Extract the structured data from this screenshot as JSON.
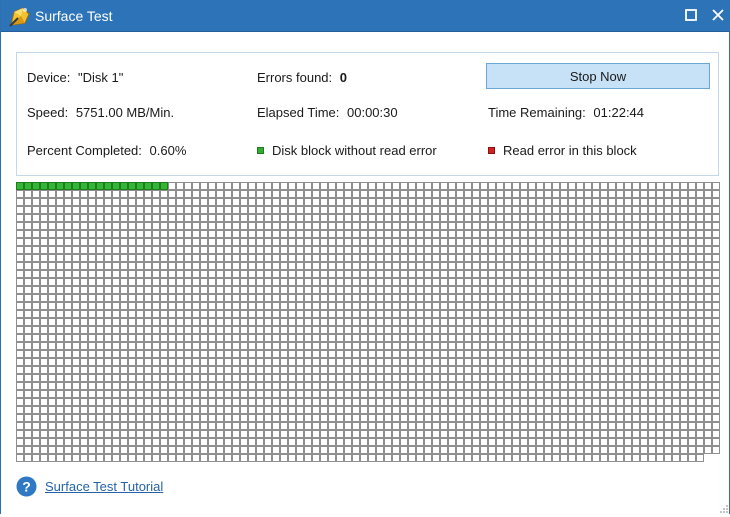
{
  "window": {
    "title": "Surface Test",
    "icon": "surface-test-app-icon",
    "maximize_icon": "maximize-icon",
    "close_icon": "close-icon"
  },
  "info": {
    "device_label": "Device:",
    "device_value": "\"Disk 1\"",
    "errors_label": "Errors found:",
    "errors_value": "0",
    "speed_label": "Speed:",
    "speed_value": "5751.00 MB/Min.",
    "elapsed_label": "Elapsed Time:",
    "elapsed_value": "00:00:30",
    "remaining_label": "Time Remaining:",
    "remaining_value": "01:22:44",
    "percent_label": "Percent Completed:",
    "percent_value": "0.60%",
    "legend_ok": "Disk block without read error",
    "legend_err": "Read error in this block"
  },
  "actions": {
    "stop_label": "Stop Now"
  },
  "block_map": {
    "rows": 35,
    "cols": 88,
    "last_row_cols": 86,
    "scanned_blocks": 19,
    "error_blocks": 0
  },
  "footer": {
    "help_icon": "help-icon",
    "tutorial_link": "Surface Test Tutorial"
  },
  "colors": {
    "titlebar": "#2d73b8",
    "button_bg": "#c7e2f7",
    "ok_block": "#35b535",
    "error_block": "#d42020",
    "link": "#2563a6"
  }
}
